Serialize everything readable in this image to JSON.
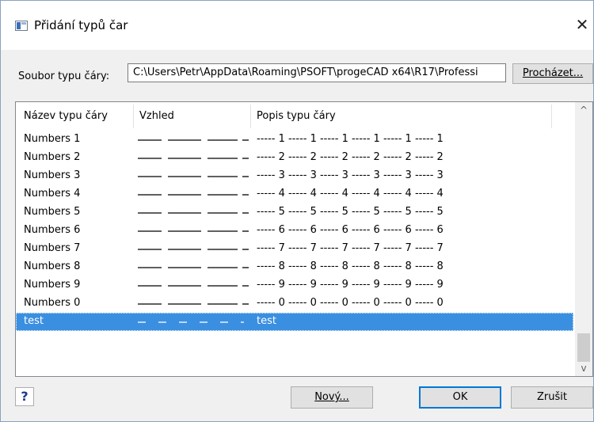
{
  "window": {
    "title": "Přidání typů čar",
    "close_glyph": "✕"
  },
  "file": {
    "label": "Soubor typu čáry:",
    "path": "C:\\Users\\Petr\\AppData\\Roaming\\PSOFT\\progeCAD x64\\R17\\Professi",
    "browse_label": "Procházet..."
  },
  "list": {
    "columns": [
      "Název typu čáry",
      "Vzhled",
      "Popis typu čáry"
    ],
    "rows": [
      {
        "name": "Numbers 1",
        "description": "----- 1 ----- 1 ----- 1 ----- 1 ----- 1 ----- 1",
        "pattern": "long-dash"
      },
      {
        "name": "Numbers 2",
        "description": "----- 2 ----- 2 ----- 2 ----- 2 ----- 2 ----- 2",
        "pattern": "long-dash"
      },
      {
        "name": "Numbers 3",
        "description": "----- 3 ----- 3 ----- 3 ----- 3 ----- 3 ----- 3",
        "pattern": "long-dash"
      },
      {
        "name": "Numbers 4",
        "description": "----- 4 ----- 4 ----- 4 ----- 4 ----- 4 ----- 4",
        "pattern": "long-dash"
      },
      {
        "name": "Numbers 5",
        "description": "----- 5 ----- 5 ----- 5 ----- 5 ----- 5 ----- 5",
        "pattern": "long-dash"
      },
      {
        "name": "Numbers 6",
        "description": "----- 6 ----- 6 ----- 6 ----- 6 ----- 6 ----- 6",
        "pattern": "long-dash"
      },
      {
        "name": "Numbers 7",
        "description": "----- 7 ----- 7 ----- 7 ----- 7 ----- 7 ----- 7",
        "pattern": "long-dash"
      },
      {
        "name": "Numbers 8",
        "description": "----- 8 ----- 8 ----- 8 ----- 8 ----- 8 ----- 8",
        "pattern": "long-dash"
      },
      {
        "name": "Numbers 9",
        "description": "----- 9 ----- 9 ----- 9 ----- 9 ----- 9 ----- 9",
        "pattern": "long-dash"
      },
      {
        "name": "Numbers 0",
        "description": "----- 0 ----- 0 ----- 0 ----- 0 ----- 0 ----- 0",
        "pattern": "long-dash"
      },
      {
        "name": "test",
        "description": "test",
        "pattern": "short-dash",
        "selected": true
      }
    ]
  },
  "buttons": {
    "help": "?",
    "new": "Nový...",
    "ok": "OK",
    "cancel": "Zrušit"
  },
  "icons": {
    "app": "dialog-app-icon",
    "close": "close-icon",
    "scroll_up": "scroll-up-icon",
    "scroll_down": "scroll-down-icon",
    "scroll_up_glyph": "^",
    "scroll_down_glyph": "v"
  },
  "colors": {
    "selection": "#3b8fe0",
    "ok_border": "#0078d7",
    "help_question": "#1a3a8a"
  }
}
